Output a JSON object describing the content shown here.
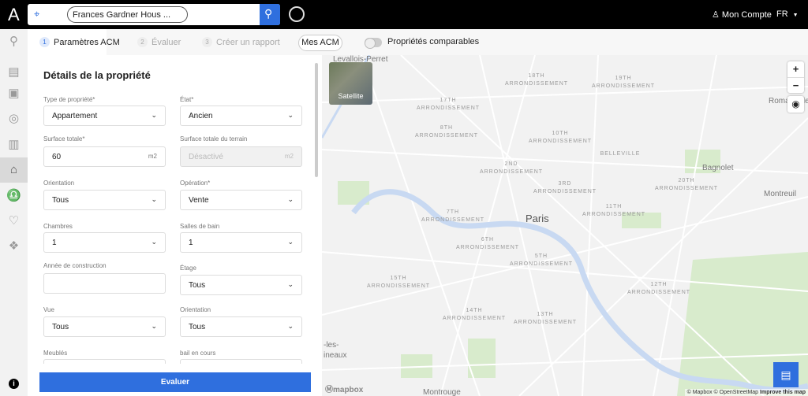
{
  "header": {
    "logo": "A",
    "search_value": "Frances Gardner Hous ...",
    "account_label": "Mon Compte",
    "language": "FR",
    "icons": [
      "map-pin-icon",
      "search-icon",
      "refresh-icon",
      "user-icon",
      "caret-down-icon"
    ]
  },
  "tabs": [
    {
      "num": "1",
      "label": "Paramètres ACM",
      "active": true
    },
    {
      "num": "2",
      "label": "Évaluer"
    },
    {
      "num": "3",
      "label": "Créer un rapport"
    }
  ],
  "mes_acm": "Mes ACM",
  "toggle": {
    "label": "Propriétés comparables",
    "on": false
  },
  "sidebar": [
    "search-icon",
    "building-search-icon",
    "valuation-icon",
    "market-analysis-icon",
    "chart-icon",
    "home-icon",
    "bell-icon",
    "heart-icon",
    "handshake-icon",
    "info-icon"
  ],
  "form": {
    "title": "Détails de la propriété",
    "fields": {
      "type": {
        "label": "Type de propriété*",
        "value": "Appartement"
      },
      "etat": {
        "label": "État*",
        "value": "Ancien"
      },
      "surface": {
        "label": "Surface totale*",
        "value": "60",
        "unit": "m2"
      },
      "terrain": {
        "label": "Surface totale du terrain",
        "value": "Désactivé",
        "unit": "m2"
      },
      "orientation": {
        "label": "Orientation",
        "value": "Tous"
      },
      "operation": {
        "label": "Opération*",
        "value": "Vente"
      },
      "chambres": {
        "label": "Chambres",
        "value": "1"
      },
      "salles": {
        "label": "Salles de bain",
        "value": "1"
      },
      "annee": {
        "label": "Année de construction",
        "value": ""
      },
      "etage": {
        "label": "Étage",
        "value": "Tous"
      },
      "vue": {
        "label": "Vue",
        "value": "Tous"
      },
      "orientation2": {
        "label": "Orientation",
        "value": "Tous"
      },
      "meubles": {
        "label": "Meublés"
      },
      "bail": {
        "label": "bail en cours"
      }
    },
    "submit": "Evaluer"
  },
  "map": {
    "satellite": "Satellite",
    "zoom_in": "+",
    "zoom_out": "−",
    "mapbox": "mapbox",
    "attribution": "© Mapbox © OpenStreetMap",
    "improve": "Improve this map",
    "colors": {
      "water": "#c8d9f2",
      "park": "#d8ebcc",
      "road": "#ffffff",
      "accent": "#2f6fde"
    },
    "places": [
      "Levallois-Perret",
      "Romainville",
      "Bagnolet",
      "Montreuil",
      "BELLEVILLE",
      "Paris",
      "-les-\nineaux",
      "Montrouge"
    ],
    "districts": [
      "18TH",
      "17TH",
      "19TH",
      "8TH",
      "10TH",
      "2ND",
      "3RD",
      "20TH",
      "11TH",
      "7TH",
      "6TH",
      "5TH",
      "15TH",
      "12TH",
      "14TH",
      "13TH"
    ],
    "district_word": "ARRONDISSEMENT"
  }
}
